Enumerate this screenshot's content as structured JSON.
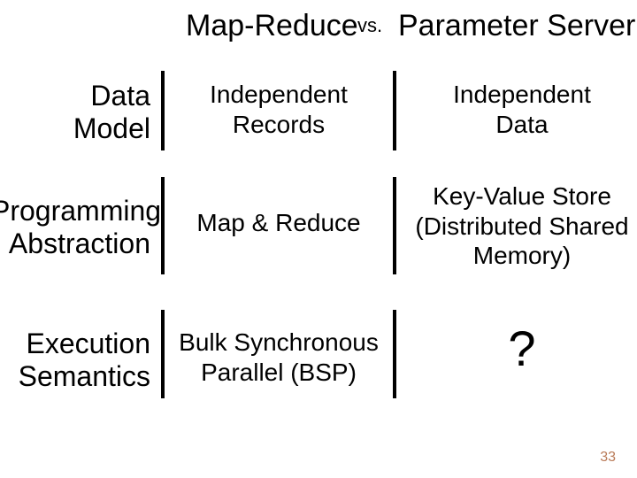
{
  "title": {
    "left": "Map-Reduce",
    "vs": "vs.",
    "right": "Parameter Server"
  },
  "rows": {
    "r1": {
      "label": "Data\nModel",
      "col1": "Independent\nRecords",
      "col2": "Independent\nData"
    },
    "r2": {
      "label": "Programming\nAbstraction",
      "col1": "Map & Reduce",
      "col2": "Key-Value Store\n(Distributed Shared\nMemory)"
    },
    "r3": {
      "label": "Execution\nSemantics",
      "col1": "Bulk Synchronous\nParallel (BSP)",
      "col2": "?"
    }
  },
  "page_number": "33"
}
